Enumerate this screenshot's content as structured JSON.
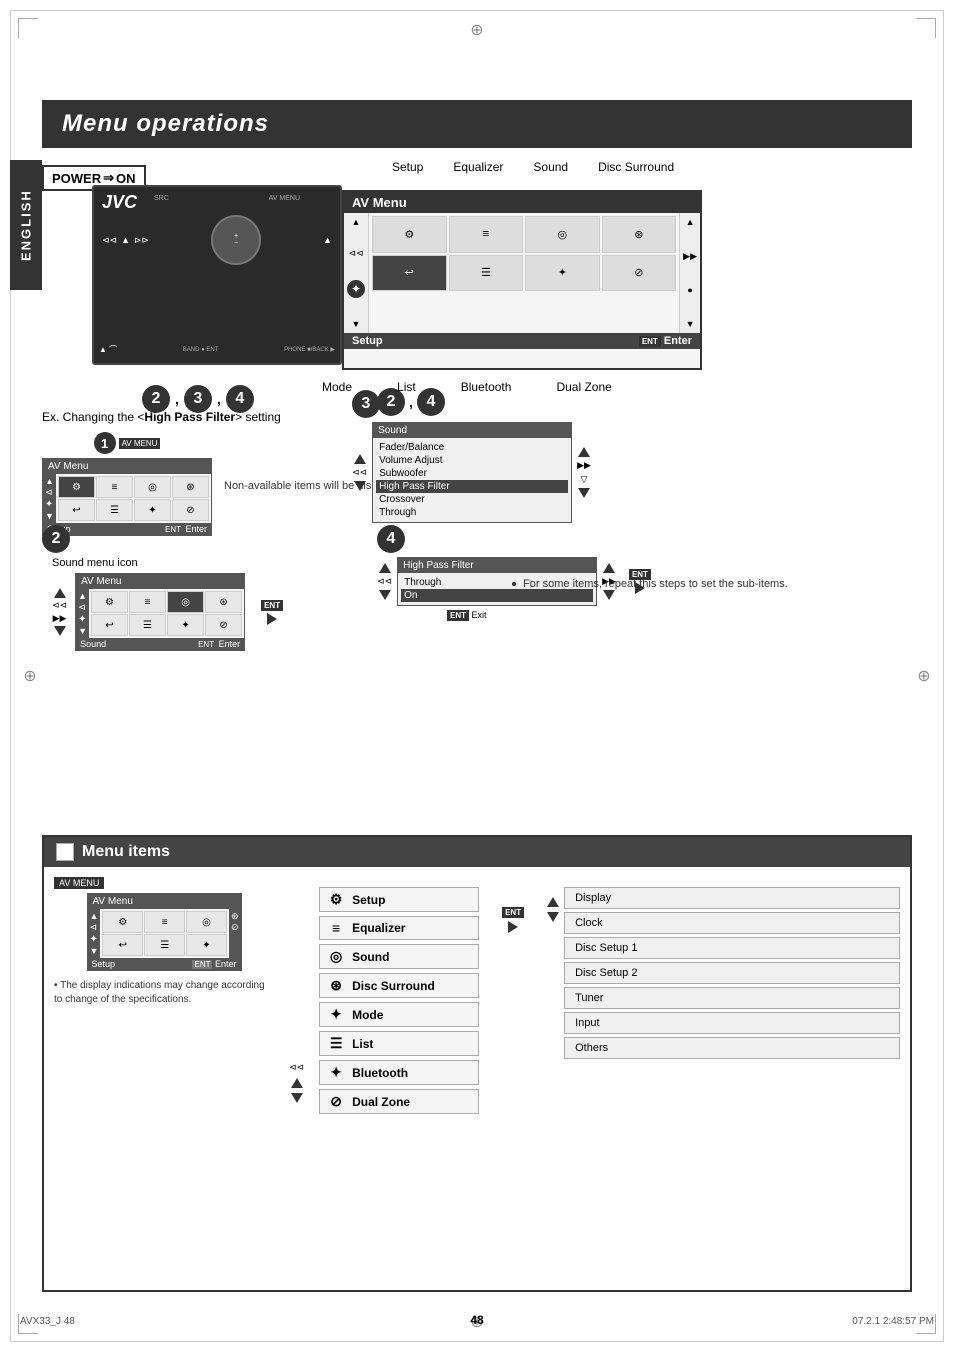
{
  "page": {
    "title": "Menu operations",
    "page_number": "48",
    "footer_left": "AVX33_J   48",
    "footer_right": "07.2.1   2:48:57 PM"
  },
  "english_tab": "ENGLISH",
  "power_label": "POWER",
  "power_arrow": "⇒",
  "power_on": "ON",
  "menu_tabs": {
    "setup": "Setup",
    "equalizer": "Equalizer",
    "sound": "Sound",
    "disc_surround": "Disc Surround"
  },
  "bottom_labels": {
    "mode": "Mode",
    "list": "List",
    "bluetooth": "Bluetooth",
    "dual_zone": "Dual Zone"
  },
  "step_numbers": [
    "❶",
    "❷",
    "❸",
    "❹"
  ],
  "av_menu_label": "AV Menu",
  "setup_label": "Setup",
  "enter_label": "Enter",
  "ent_label": "ENT",
  "example_text": "Ex. Changing the <High Pass Filter> setting",
  "step2_label": "Sound menu icon",
  "note_text": "Non-available items will be displayed being shaded.",
  "note2_text": "For some items, repeat this steps to set the sub-items.",
  "sound_menu_items": {
    "title": "Sound",
    "items": [
      "Fader/Balance",
      "Volume Adjust",
      "Subwoofer",
      "High Pass Filter",
      "Crossover",
      "Through"
    ]
  },
  "hpf_menu": {
    "title": "High Pass Filter",
    "items": [
      "Through",
      "On"
    ]
  },
  "menu_items_section": {
    "title": "Menu items",
    "items": [
      {
        "label": "Setup",
        "icon": "⚙"
      },
      {
        "label": "Equalizer",
        "icon": "≡"
      },
      {
        "label": "Sound",
        "icon": "◎"
      },
      {
        "label": "Disc Surround",
        "icon": "⊛"
      },
      {
        "label": "Mode",
        "icon": "✦"
      },
      {
        "label": "List",
        "icon": "☰"
      },
      {
        "label": "Bluetooth",
        "icon": "✦"
      },
      {
        "label": "Dual Zone",
        "icon": "⊘"
      }
    ],
    "sub_items": [
      "Display",
      "Clock",
      "Disc Setup 1",
      "Disc Setup 2",
      "Tuner",
      "Input",
      "Others"
    ]
  },
  "note_bottom": "• The display indications may change according to change of the specifications."
}
